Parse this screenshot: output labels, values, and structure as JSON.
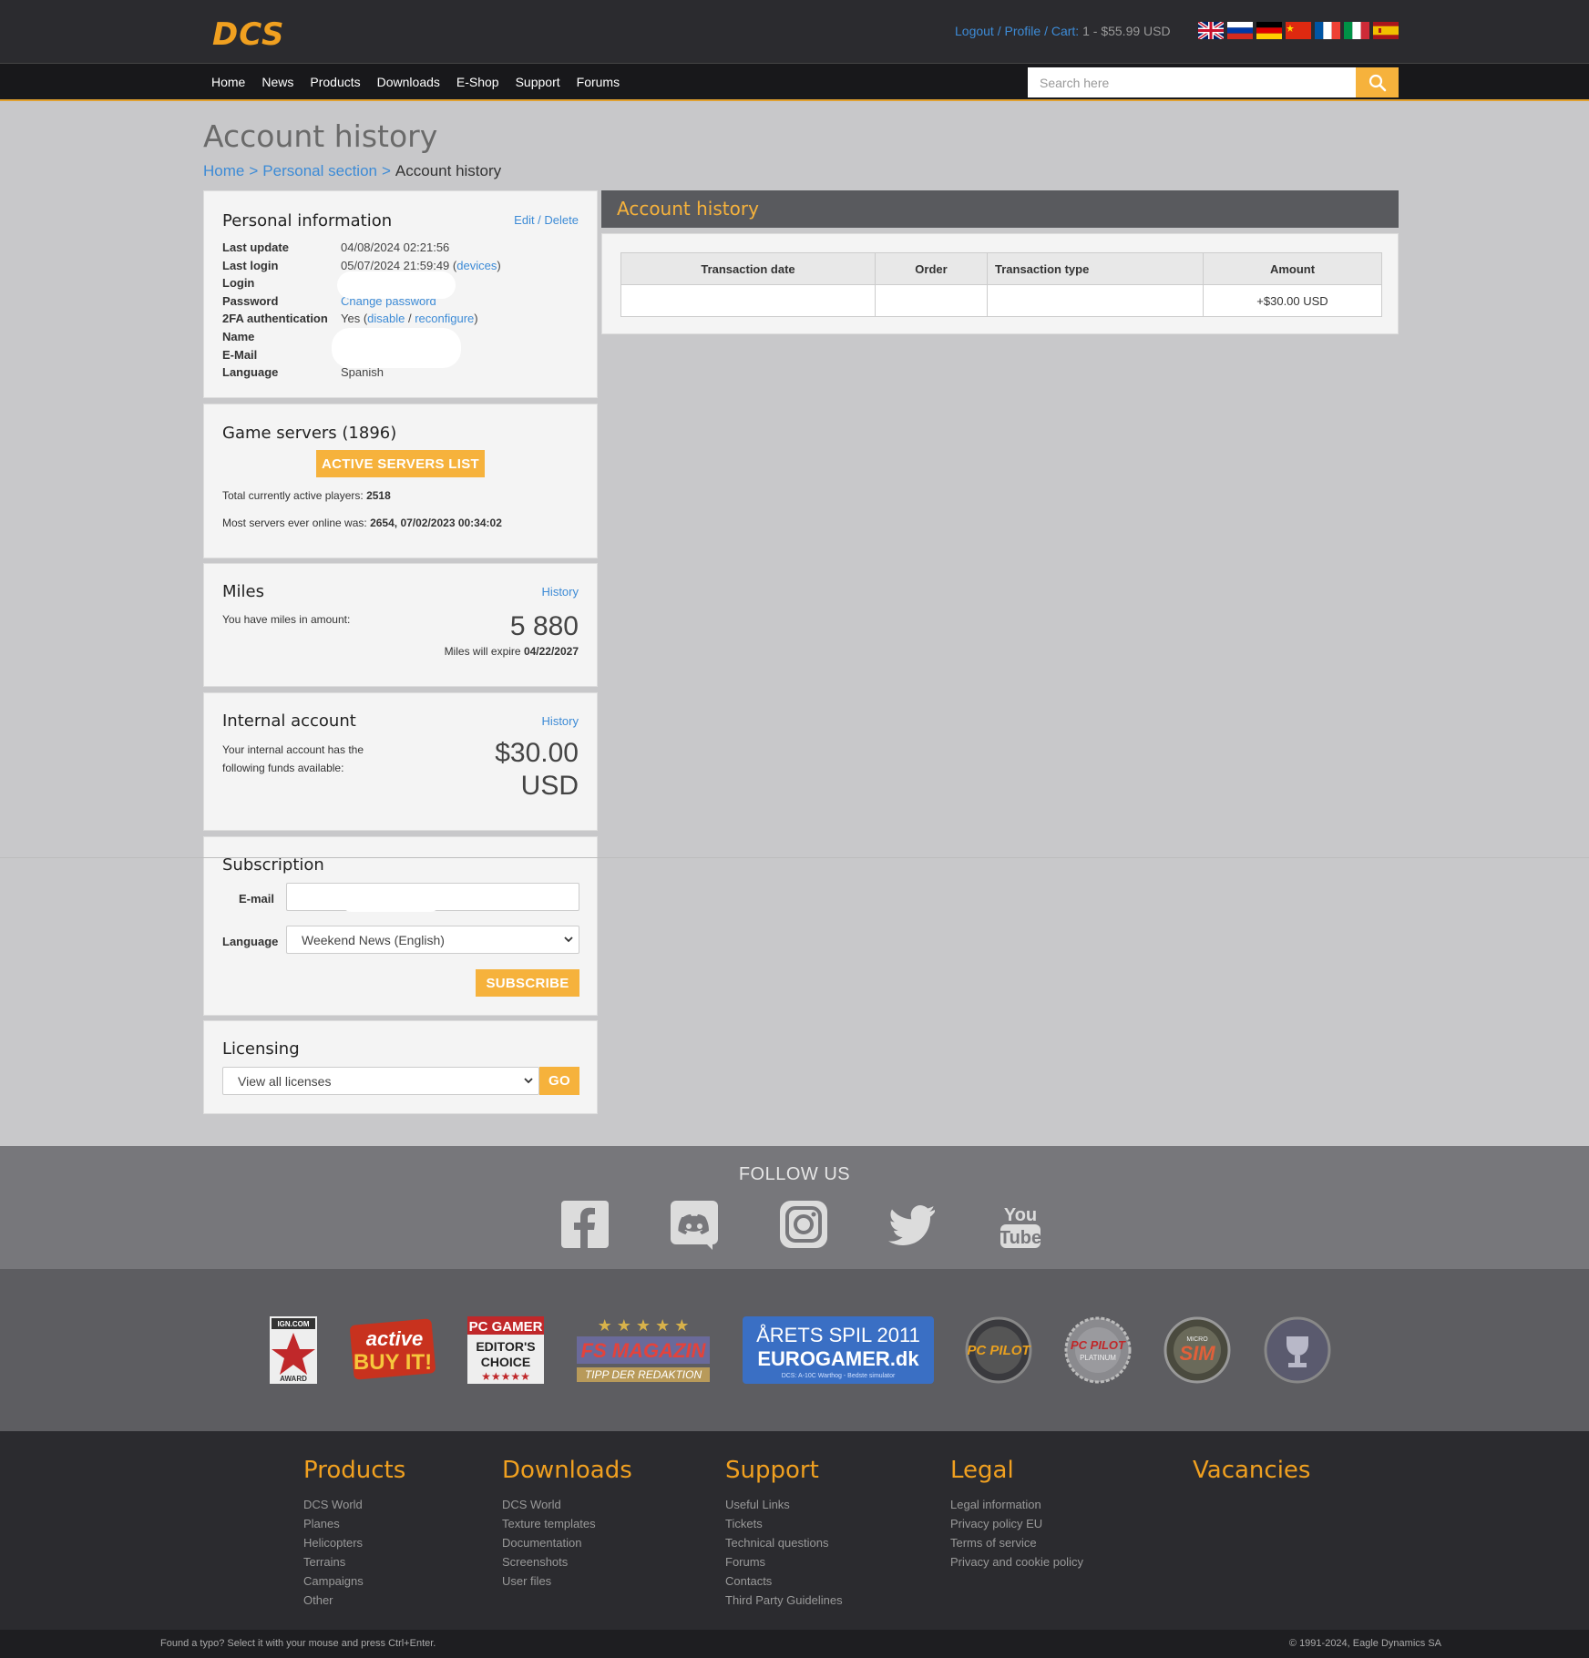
{
  "header": {
    "logo": "DCS",
    "logout": "Logout",
    "profile": "Profile",
    "cart_label": "Cart:",
    "cart_value": "1 - $55.99 USD",
    "languages": [
      "English",
      "Russian",
      "German",
      "Chinese",
      "French",
      "Italian",
      "Spanish"
    ]
  },
  "nav": {
    "items": [
      "Home",
      "News",
      "Products",
      "Downloads",
      "E-Shop",
      "Support",
      "Forums"
    ],
    "search_placeholder": "Search here",
    "search_icon": "search-icon"
  },
  "page": {
    "title": "Account history",
    "breadcrumb": [
      "Home",
      "Personal section",
      "Account history"
    ]
  },
  "personal_info": {
    "title": "Personal information",
    "edit_delete": "Edit / Delete",
    "rows": [
      {
        "key": "Last update",
        "value": "04/08/2024 02:21:56"
      },
      {
        "key": "Last login",
        "value": "05/07/2024 21:59:49",
        "link": "devices"
      },
      {
        "key": "Login",
        "value": ""
      },
      {
        "key": "Password",
        "link": "Change password"
      },
      {
        "key": "2FA authentication",
        "value": "Yes",
        "link1": "disable",
        "link2": "reconfigure"
      },
      {
        "key": "Name",
        "value": ""
      },
      {
        "key": "E-Mail",
        "value": ""
      },
      {
        "key": "Language",
        "value": "Spanish"
      }
    ]
  },
  "game_servers": {
    "title": "Game servers (1896)",
    "button": "ACTIVE SERVERS LIST",
    "players_label": "Total currently active players:",
    "players_value": "2518",
    "max_label": "Most servers ever online was:",
    "max_value": "2654, 07/02/2023 00:34:02"
  },
  "miles": {
    "title": "Miles",
    "history": "History",
    "label": "You have miles in amount:",
    "amount": "5 880",
    "expire_label": "Miles will expire",
    "expire_date": "04/22/2027"
  },
  "internal_account": {
    "title": "Internal account",
    "history": "History",
    "label": "Your internal account has the following funds available:",
    "amount": "$30.00",
    "currency": "USD"
  },
  "subscription": {
    "title": "Subscription",
    "email_label": "E-mail",
    "language_label": "Language",
    "language_value": "Weekend News (English)",
    "button": "SUBSCRIBE"
  },
  "licensing": {
    "title": "Licensing",
    "select_value": "View all licenses",
    "button": "GO"
  },
  "account_history": {
    "title": "Account history",
    "columns": [
      "Transaction date",
      "Order",
      "Transaction type",
      "Amount"
    ],
    "rows": [
      {
        "date": "",
        "order": "",
        "type": "",
        "amount": "+$30.00 USD"
      }
    ]
  },
  "follow": {
    "title": "FOLLOW US",
    "icons": [
      "facebook-icon",
      "discord-icon",
      "instagram-icon",
      "twitter-icon",
      "youtube-icon"
    ]
  },
  "awards": [
    "IGN.COM AWARD",
    "active BUY IT!",
    "PC GAMER EDITOR'S CHOICE",
    "FS MAGAZIN TIPP DER REDAKTION",
    "ÅRETS SPIL 2011 EUROGAMER.dk",
    "PC PILOT",
    "PC PILOT PLATINUM",
    "MICRO SIM",
    "award badge"
  ],
  "footer": {
    "columns": [
      {
        "title": "Products",
        "items": [
          "DCS World",
          "Planes",
          "Helicopters",
          "Terrains",
          "Campaigns",
          "Other"
        ]
      },
      {
        "title": "Downloads",
        "items": [
          "DCS World",
          "Texture templates",
          "Documentation",
          "Screenshots",
          "User files"
        ]
      },
      {
        "title": "Support",
        "items": [
          "Useful Links",
          "Tickets",
          "Technical questions",
          "Forums",
          "Contacts",
          "Third Party Guidelines"
        ]
      },
      {
        "title": "Legal",
        "items": [
          "Legal information",
          "Privacy policy EU",
          "Terms of service",
          "Privacy and cookie policy"
        ]
      },
      {
        "title": "Vacancies",
        "items": []
      }
    ],
    "typo_note": "Found a typo? Select it with your mouse and press Ctrl+Enter.",
    "copyright": "© 1991-2024, Eagle Dynamics SA"
  },
  "colors": {
    "accent": "#f6b23c",
    "link": "#3d8bd6",
    "positive": "#2e8b2e"
  }
}
